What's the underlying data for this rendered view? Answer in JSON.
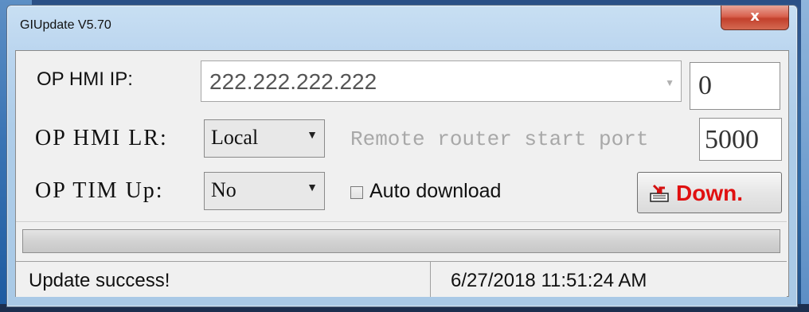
{
  "window": {
    "title": "GIUpdate V5.70",
    "close_label": "x"
  },
  "form": {
    "ip_label": "OP HMI IP:",
    "ip_value": "222.222.222.222",
    "ip_extra_value": "0",
    "lr_label": "OP HMI LR:",
    "lr_value": "Local",
    "remote_port_label": "Remote router start port",
    "remote_port_value": "5000",
    "tim_label": "OP TIM Up:",
    "tim_value": "No",
    "auto_download_label": "Auto download",
    "auto_download_checked": false,
    "download_button_label": "Down."
  },
  "progress": {
    "value": 0
  },
  "status": {
    "message": "Update success!",
    "datetime": "6/27/2018  11:51:24 AM"
  },
  "colors": {
    "download_text": "#e01010",
    "accent": "#2d6aa6"
  }
}
